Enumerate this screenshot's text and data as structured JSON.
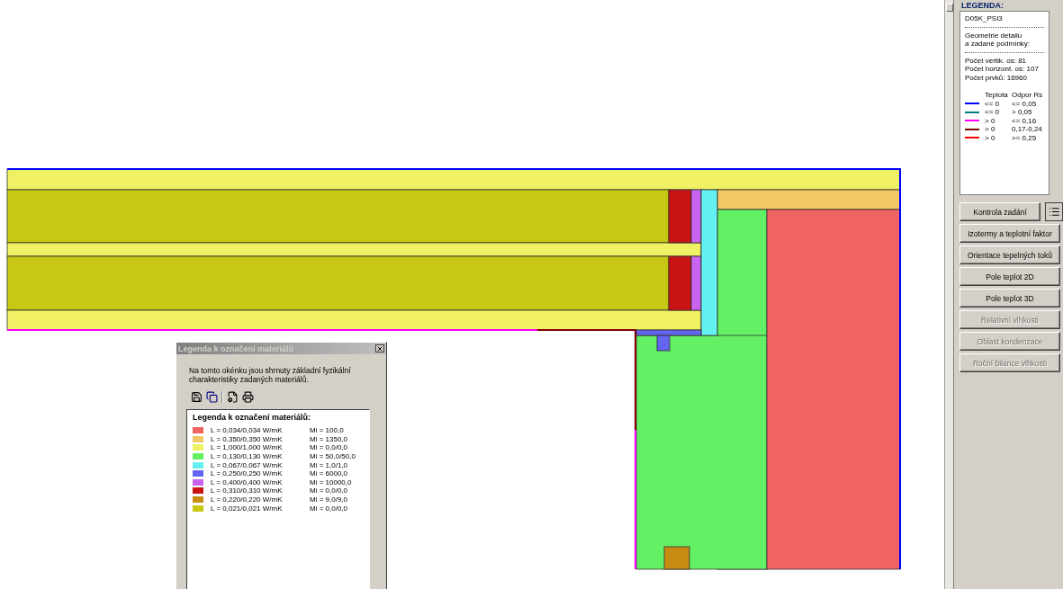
{
  "right_panel": {
    "legend": {
      "title": "LEGENDA:",
      "case_name": "D05K_PSI3",
      "geometry_lines": [
        "Geometrie detailu",
        "a zadané podmínky:"
      ],
      "stats": [
        "Počet vertik. os: 81",
        "Počet horizont. os: 107",
        "Počet prvků: 16960"
      ],
      "line_columns": [
        "Teplota",
        "Odpor Rs"
      ],
      "lines": [
        {
          "color": "#0000ff",
          "temperature": "<= 0",
          "resistance": "<= 0,05"
        },
        {
          "color": "#008080",
          "temperature": "<= 0",
          "resistance": "> 0,05"
        },
        {
          "color": "#ff00ff",
          "temperature": "> 0",
          "resistance": "<= 0,16"
        },
        {
          "color": "#800000",
          "temperature": "> 0",
          "resistance": "0,17-0,24"
        },
        {
          "color": "#ff0000",
          "temperature": "> 0",
          "resistance": ">= 0,25"
        }
      ]
    },
    "buttons": [
      {
        "label": "Kontrola zadání",
        "disabled": false
      },
      {
        "label": "Izotermy a teplotní faktor",
        "disabled": false
      },
      {
        "label": "Orientace tepelných toků",
        "disabled": false
      },
      {
        "label": "Pole teplot 2D",
        "disabled": false
      },
      {
        "label": "Pole teplot 3D",
        "disabled": false
      },
      {
        "label": "Relativní vlhkosti",
        "disabled": true
      },
      {
        "label": "Oblast kondenzace",
        "disabled": true
      },
      {
        "label": "Roční bilance vlhkosti",
        "disabled": true
      }
    ]
  },
  "dialog": {
    "title": "Legenda k označení materiálů",
    "description": "Na tomto okénku jsou shrnuty základní fyzikální charakteristiky zadaných materiálů.",
    "list_heading": "Legenda k označení materiálů:",
    "materials": [
      {
        "color": "#f06464",
        "lambda": "L = 0,034/0,034 W/mK",
        "mi": "Mi = 100,0"
      },
      {
        "color": "#f0c864",
        "lambda": "L = 0,350/0,350 W/mK",
        "mi": "Mi = 1350,0"
      },
      {
        "color": "#f0f064",
        "lambda": "L = 1,000/1,000 W/mK",
        "mi": "Mi = 0,0/0,0"
      },
      {
        "color": "#64f064",
        "lambda": "L = 0,130/0,130 W/mK",
        "mi": "Mi = 50,0/50,0"
      },
      {
        "color": "#64f0f0",
        "lambda": "L = 0,067/0,067 W/mK",
        "mi": "Mi = 1,0/1,0"
      },
      {
        "color": "#6464f0",
        "lambda": "L = 0,250/0,250 W/mK",
        "mi": "Mi = 6000,0"
      },
      {
        "color": "#c864f0",
        "lambda": "L = 0,400/0,400 W/mK",
        "mi": "Mi = 10000,0"
      },
      {
        "color": "#c81414",
        "lambda": "L = 0,310/0,310 W/mK",
        "mi": "Mi = 0,0/0,0"
      },
      {
        "color": "#c88c14",
        "lambda": "L = 0,220/0,220 W/mK",
        "mi": "Mi = 9,0/9,0"
      },
      {
        "color": "#c8c814",
        "lambda": "L = 0,021/0,021 W/mK",
        "mi": "Mi = 0,0/0,0"
      }
    ]
  }
}
